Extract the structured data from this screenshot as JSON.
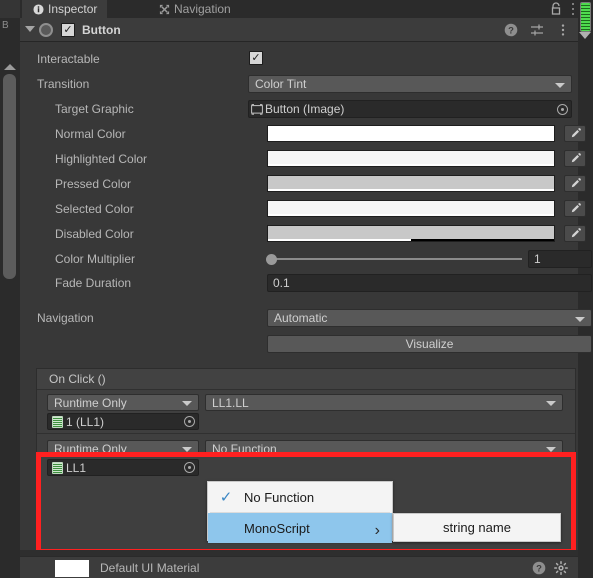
{
  "tabs": [
    {
      "label": "Inspector",
      "icon": "info-icon",
      "active": true
    },
    {
      "label": "Navigation",
      "icon": "navigation-icon",
      "active": false
    }
  ],
  "component_header": {
    "title": "Button",
    "enabled": true,
    "check_glyph": "✓",
    "help_glyph": "?",
    "preset_name": "preset-icon",
    "menu_name": "kebab-menu-icon",
    "lock_name": "lock-icon"
  },
  "properties": {
    "interactable": {
      "label": "Interactable",
      "value": true,
      "check_glyph": "✓"
    },
    "transition": {
      "label": "Transition",
      "value": "Color Tint"
    },
    "target_graphic": {
      "label": "Target Graphic",
      "value": "Button (Image)"
    },
    "normal_color": {
      "label": "Normal Color",
      "color": "#ffffff",
      "alpha_pct": 100
    },
    "highlighted_color": {
      "label": "Highlighted Color",
      "color": "#f5f5f5",
      "alpha_pct": 100
    },
    "pressed_color": {
      "label": "Pressed Color",
      "color": "#c8c8c8",
      "alpha_pct": 100
    },
    "selected_color": {
      "label": "Selected Color",
      "color": "#f5f5f5",
      "alpha_pct": 100
    },
    "disabled_color": {
      "label": "Disabled Color",
      "color": "#c8c8c8",
      "alpha_pct": 50
    },
    "color_multiplier": {
      "label": "Color Multiplier",
      "value": "1",
      "slider_pct": 0
    },
    "fade_duration": {
      "label": "Fade Duration",
      "value": "0.1"
    },
    "navigation": {
      "label": "Navigation",
      "value": "Automatic"
    },
    "visualize": {
      "label": "Visualize"
    }
  },
  "on_click": {
    "title": "On Click ()",
    "rows": [
      {
        "mode": "Runtime Only",
        "function": "LL1.LL",
        "object": "1 (LL1)",
        "highlighted": false
      },
      {
        "mode": "Runtime Only",
        "function": "No Function",
        "object": "LL1",
        "highlighted": true
      }
    ]
  },
  "dropdown_menu": {
    "items": [
      {
        "label": "No Function",
        "checked": true,
        "selected": false,
        "has_submenu": false
      },
      {
        "label": "MonoScript",
        "checked": false,
        "selected": true,
        "has_submenu": true
      }
    ],
    "check_glyph": "✓",
    "submenu_arrow": "›",
    "submenu": {
      "items": [
        {
          "label": "string name"
        }
      ]
    }
  },
  "material_bar": {
    "label": "Default UI Material",
    "swatch_color": "#ffffff",
    "help_glyph": "?",
    "gear_name": "gear-icon"
  },
  "left_strip": {
    "label": "B"
  },
  "colors": {
    "panel_bg": "#383838",
    "header_bg": "#3c3c3c",
    "field_bg": "#2a2a2a",
    "popup_bg": "#585858",
    "highlight_red": "#ff2020",
    "menu_select_blue": "#8ec6ec",
    "meter_green": "#4fdc4f"
  }
}
